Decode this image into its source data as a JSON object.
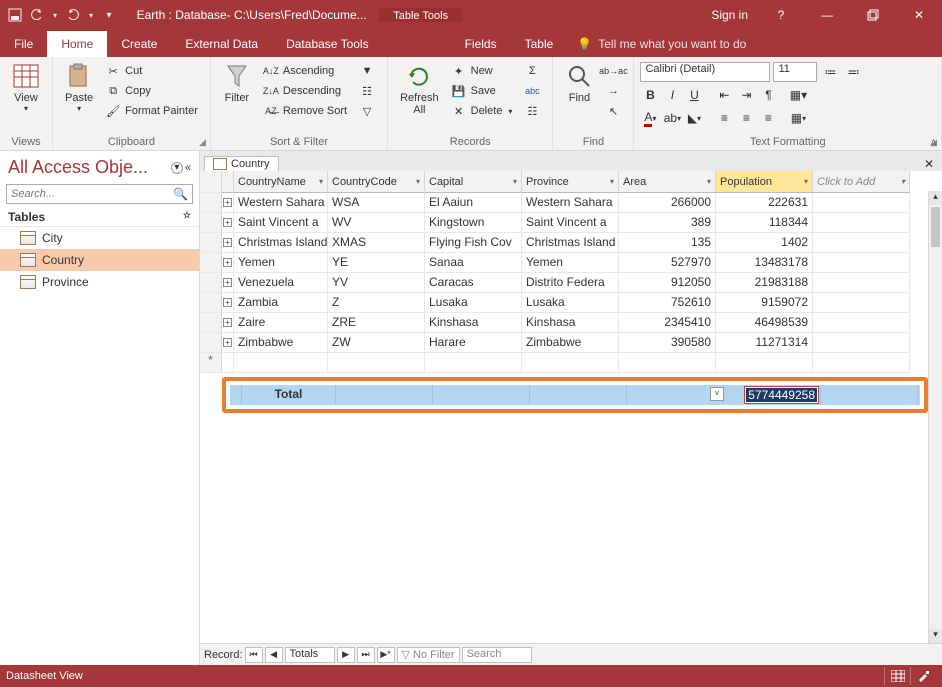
{
  "titlebar": {
    "app_title": "Earth : Database- C:\\Users\\Fred\\Docume...",
    "context_tab": "Table Tools",
    "signin": "Sign in"
  },
  "ribbon_tabs": [
    "File",
    "Home",
    "Create",
    "External Data",
    "Database Tools",
    "Fields",
    "Table"
  ],
  "active_tab": "Home",
  "tell_me_placeholder": "Tell me what you want to do",
  "ribbon": {
    "views": {
      "label": "Views",
      "view": "View"
    },
    "clipboard": {
      "label": "Clipboard",
      "paste": "Paste",
      "cut": "Cut",
      "copy": "Copy",
      "fmt": "Format Painter"
    },
    "sortfilter": {
      "label": "Sort & Filter",
      "filter": "Filter",
      "asc": "Ascending",
      "desc": "Descending",
      "remove": "Remove Sort"
    },
    "records": {
      "label": "Records",
      "refresh": "Refresh\nAll",
      "new": "New",
      "save": "Save",
      "delete": "Delete"
    },
    "find": {
      "label": "Find",
      "find": "Find"
    },
    "textfmt": {
      "label": "Text Formatting",
      "font_name": "Calibri (Detail)",
      "font_size": "11"
    }
  },
  "navpane": {
    "title": "All Access Obje...",
    "search_placeholder": "Search...",
    "section": "Tables",
    "items": [
      "City",
      "Country",
      "Province"
    ],
    "selected": "Country"
  },
  "doc": {
    "tab_label": "Country",
    "columns": [
      "CountryName",
      "CountryCode",
      "Capital",
      "Province",
      "Area",
      "Population",
      "Click to Add"
    ],
    "active_col": "Population",
    "rows": [
      {
        "name": "Western Sahara",
        "code": "WSA",
        "capital": "El Aaiun",
        "province": "Western Sahara",
        "area": "266000",
        "pop": "222631"
      },
      {
        "name": "Saint Vincent a",
        "code": "WV",
        "capital": "Kingstown",
        "province": "Saint Vincent a",
        "area": "389",
        "pop": "118344"
      },
      {
        "name": "Christmas Island",
        "code": "XMAS",
        "capital": "Flying Fish Cov",
        "province": "Christmas Island",
        "area": "135",
        "pop": "1402"
      },
      {
        "name": "Yemen",
        "code": "YE",
        "capital": "Sanaa",
        "province": "Yemen",
        "area": "527970",
        "pop": "13483178"
      },
      {
        "name": "Venezuela",
        "code": "YV",
        "capital": "Caracas",
        "province": "Distrito Federa",
        "area": "912050",
        "pop": "21983188"
      },
      {
        "name": "Zambia",
        "code": "Z",
        "capital": "Lusaka",
        "province": "Lusaka",
        "area": "752610",
        "pop": "9159072"
      },
      {
        "name": "Zaire",
        "code": "ZRE",
        "capital": "Kinshasa",
        "province": "Kinshasa",
        "area": "2345410",
        "pop": "46498539"
      },
      {
        "name": "Zimbabwe",
        "code": "ZW",
        "capital": "Harare",
        "province": "Zimbabwe",
        "area": "390580",
        "pop": "11271314"
      }
    ],
    "total_label": "Total",
    "total_value": "5774449258"
  },
  "recnav": {
    "label": "Record:",
    "current": "Totals",
    "nofilter": "No Filter",
    "search": "Search"
  },
  "statusbar": {
    "view": "Datasheet View"
  }
}
